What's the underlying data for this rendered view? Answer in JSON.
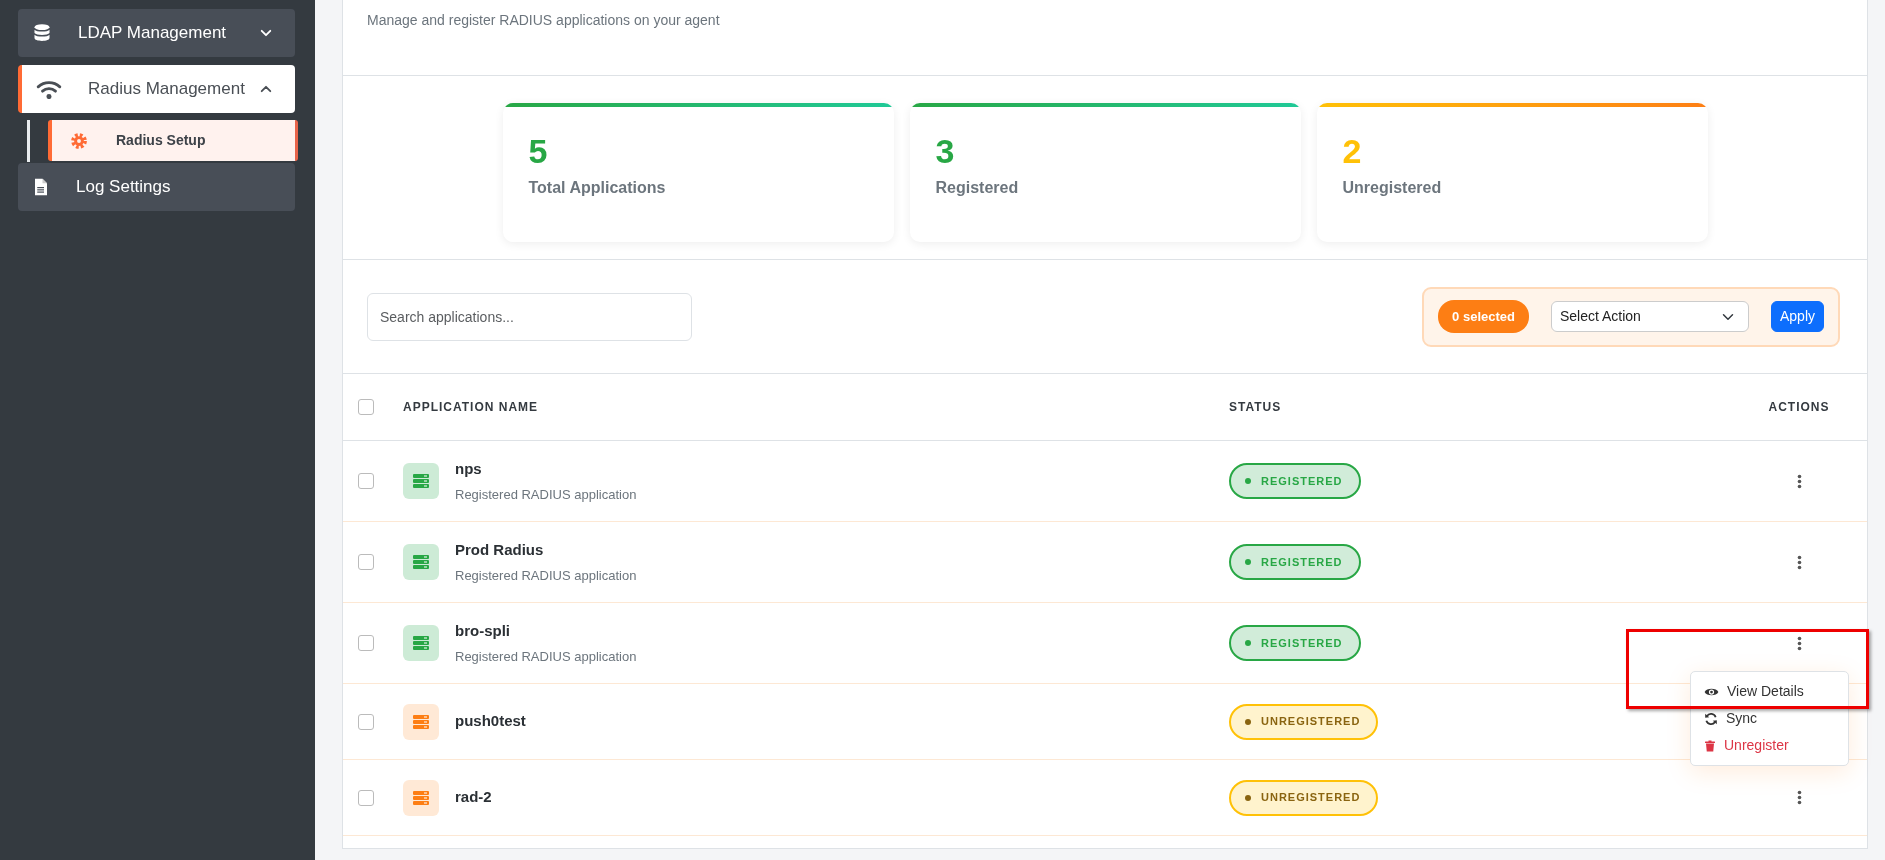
{
  "sidebar": {
    "items": [
      {
        "label": "LDAP Management",
        "expanded": false,
        "selected": false
      },
      {
        "label": "Radius Management",
        "expanded": true,
        "selected": true,
        "children": [
          {
            "label": "Radius Setup",
            "selected": true
          }
        ]
      },
      {
        "label": "Log Settings",
        "selected": false
      }
    ]
  },
  "header": {
    "subtitle": "Manage and register RADIUS applications on your agent"
  },
  "stats": [
    {
      "value": "5",
      "label": "Total Applications",
      "kind": "success"
    },
    {
      "value": "3",
      "label": "Registered",
      "kind": "success"
    },
    {
      "value": "2",
      "label": "Unregistered",
      "kind": "warning"
    }
  ],
  "toolbar": {
    "search": {
      "placeholder": "Search applications..."
    },
    "selected_count": "0 selected",
    "action_select": "Select Action",
    "apply": "Apply"
  },
  "table": {
    "select_all": {
      "checked": false
    },
    "columns": [
      "APPLICATION NAME",
      "STATUS",
      "ACTIONS"
    ],
    "rows": [
      {
        "name": "nps",
        "description": "Registered RADIUS application",
        "status": "REGISTERED",
        "kind": "registered",
        "checked": false,
        "menu_open": false
      },
      {
        "name": "Prod Radius",
        "description": "Registered RADIUS application",
        "status": "REGISTERED",
        "kind": "registered",
        "checked": false,
        "menu_open": false
      },
      {
        "name": "bro-spli",
        "description": "Registered RADIUS application",
        "status": "REGISTERED",
        "kind": "registered",
        "checked": false,
        "menu_open": true
      },
      {
        "name": "push0test",
        "status": "UNREGISTERED",
        "kind": "unregistered",
        "checked": false,
        "menu_open": false
      },
      {
        "name": "rad-2",
        "status": "UNREGISTERED",
        "kind": "unregistered",
        "checked": false,
        "menu_open": false
      }
    ]
  },
  "row_menu": {
    "highlighted": true,
    "items": [
      {
        "label": "View Details",
        "kind": "view"
      },
      {
        "label": "Sync",
        "kind": "sync"
      },
      {
        "label": "Unregister",
        "kind": "danger"
      }
    ]
  }
}
